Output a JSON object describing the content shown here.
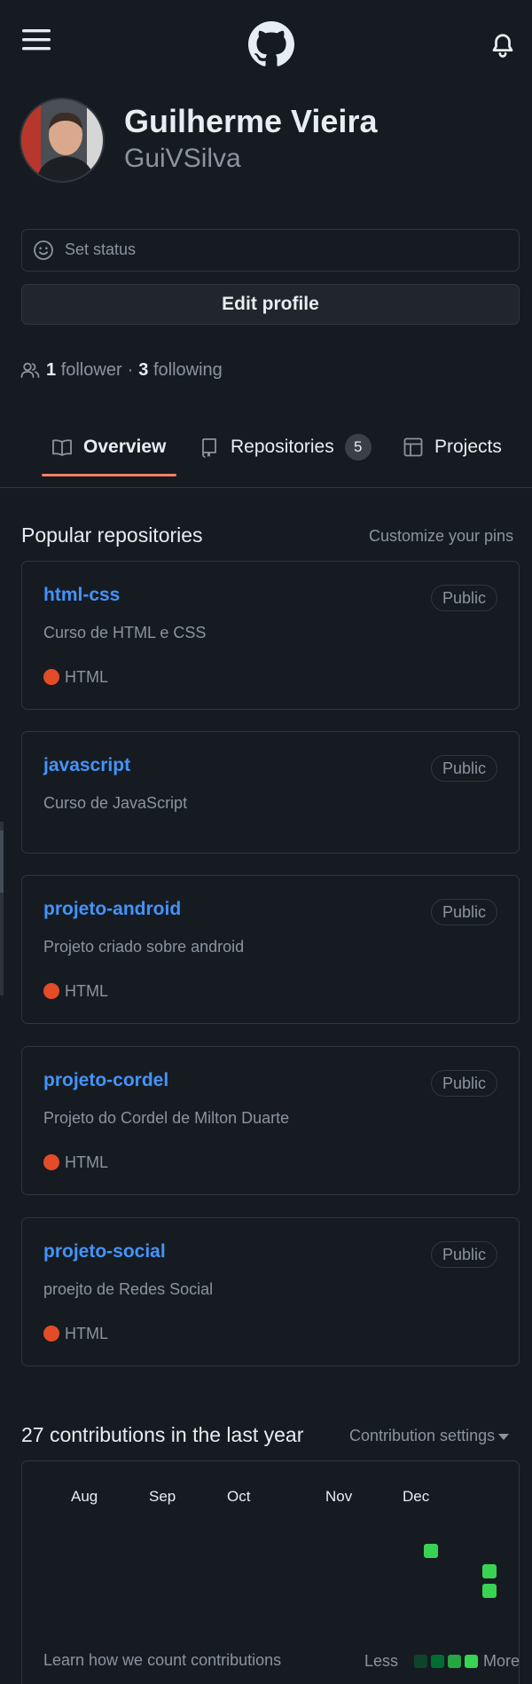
{
  "profile": {
    "name": "Guilherme Vieira",
    "login": "GuiVSilva",
    "status_placeholder": "Set status",
    "edit_label": "Edit profile",
    "followers_count": "1",
    "followers_label": "follower",
    "separator": "·",
    "following_count": "3",
    "following_label": "following"
  },
  "tabs": [
    {
      "label": "Overview",
      "icon": "book-icon",
      "selected": true
    },
    {
      "label": "Repositories",
      "icon": "repo-icon",
      "counter": "5"
    },
    {
      "label": "Projects",
      "icon": "table-icon"
    }
  ],
  "popular": {
    "title": "Popular repositories",
    "customize_label": "Customize your pins",
    "repos": [
      {
        "name": "html-css",
        "visibility": "Public",
        "description": "Curso de HTML e CSS",
        "language": "HTML"
      },
      {
        "name": "javascript",
        "visibility": "Public",
        "description": "Curso de JavaScript"
      },
      {
        "name": "projeto-android",
        "visibility": "Public",
        "description": "Projeto criado sobre android",
        "language": "HTML"
      },
      {
        "name": "projeto-cordel",
        "visibility": "Public",
        "description": "Projeto do Cordel de Milton Duarte",
        "language": "HTML"
      },
      {
        "name": "projeto-social",
        "visibility": "Public",
        "description": "proejto de Redes Social",
        "language": "HTML"
      }
    ]
  },
  "contributions": {
    "title": "27 contributions in the last year",
    "settings_label": "Contribution settings",
    "months": [
      "Aug",
      "Sep",
      "Oct",
      "Nov",
      "Dec"
    ],
    "learn_label": "Learn how we count contributions",
    "legend_less": "Less",
    "legend_more": "More",
    "legend_colors": [
      "#0e4429",
      "#006d32",
      "#26a641",
      "#39d353"
    ]
  },
  "colors": {
    "background": "#161b22",
    "link": "#4493f8",
    "accent_underline": "#f78166",
    "html_language": "#e34c26",
    "contribution_cell": "#39d353"
  }
}
